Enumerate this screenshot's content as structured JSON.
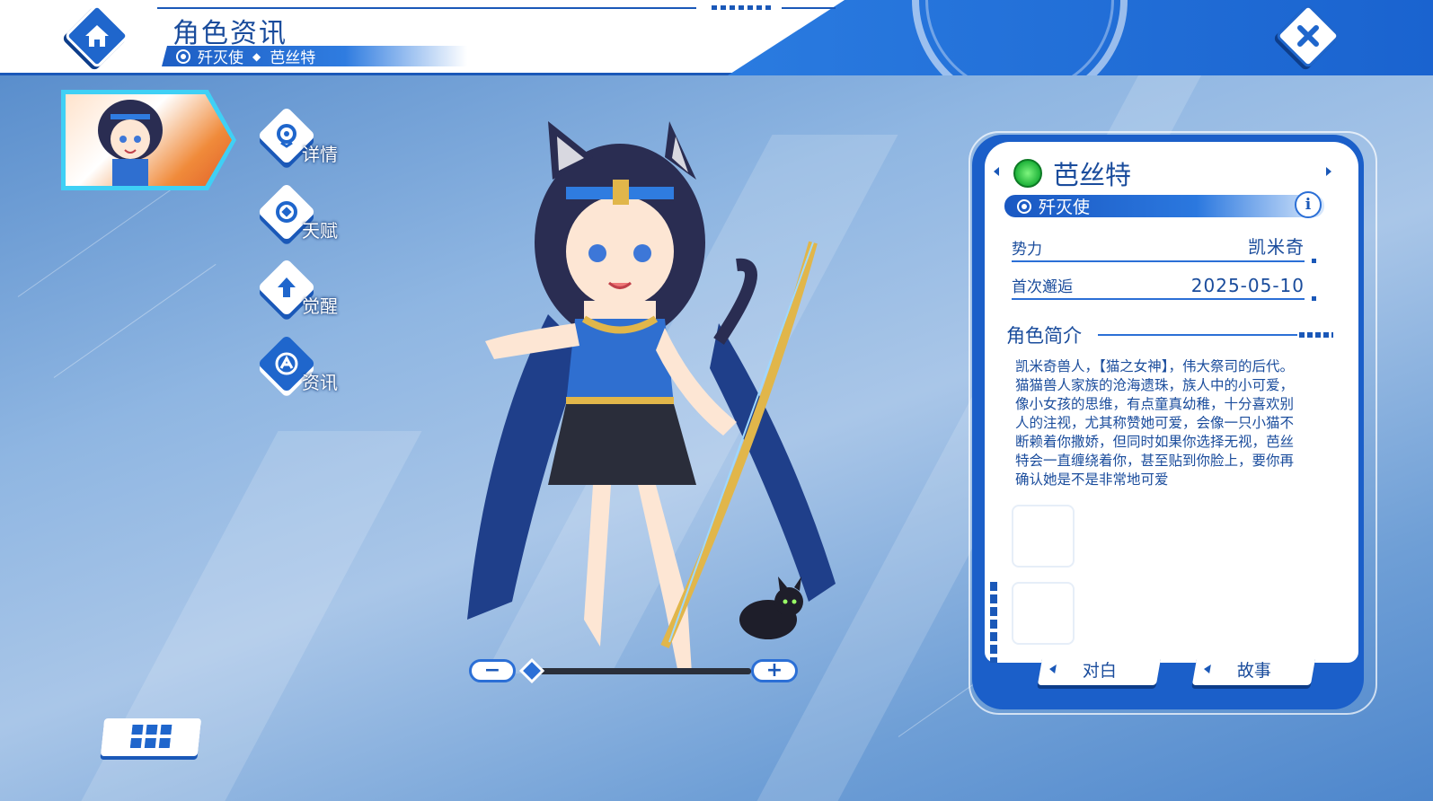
{
  "header": {
    "title": "角色资讯",
    "breadcrumb": {
      "class_name": "歼灭使",
      "character_name": "芭丝特"
    },
    "home_icon": "home-icon",
    "close_icon": "close-icon"
  },
  "side_menu": {
    "items": [
      {
        "label": "详情",
        "icon": "pin-icon"
      },
      {
        "label": "天赋",
        "icon": "talent-icon"
      },
      {
        "label": "觉醒",
        "icon": "arrow-up-icon"
      },
      {
        "label": "资讯",
        "icon": "info-emblem-icon"
      }
    ],
    "active": "资讯"
  },
  "zoom": {
    "minus": "−",
    "plus": "+",
    "level": 0.0
  },
  "panel": {
    "name": "芭丝特",
    "element_icon": "wind-element-icon",
    "class": "歼灭使",
    "info_button": "i",
    "rows": [
      {
        "key": "势力",
        "value": "凯米奇"
      },
      {
        "key": "首次邂逅",
        "value": "2025-05-10"
      }
    ],
    "section_title": "角色简介",
    "description": "凯米奇兽人，【猫之女神】，伟大祭司的后代。猫猫兽人家族的沧海遗珠，族人中的小可爱，像小女孩的思维，有点童真幼稚，十分喜欢别人的注视，尤其称赞她可爱，会像一只小猫不断赖着你撒娇，但同时如果你选择无视，芭丝特会一直缠绕着你，甚至贴到你脸上，要你再确认她是不是非常地可爱",
    "tabs": [
      "对白",
      "故事"
    ]
  },
  "colors": {
    "accent": "#1a58b8",
    "header_bg": "#ffffff",
    "panel_blue": "#1b5fc9"
  }
}
